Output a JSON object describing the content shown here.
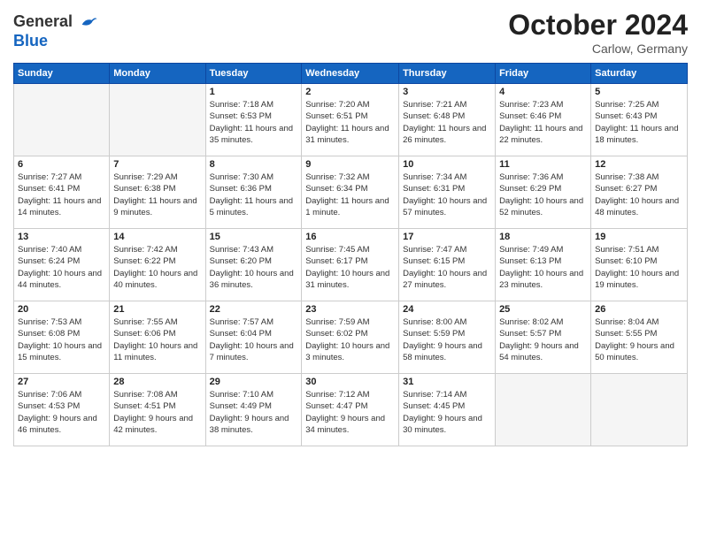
{
  "header": {
    "logo": {
      "general": "General",
      "blue": "Blue"
    },
    "title": "October 2024",
    "subtitle": "Carlow, Germany"
  },
  "days_of_week": [
    "Sunday",
    "Monday",
    "Tuesday",
    "Wednesday",
    "Thursday",
    "Friday",
    "Saturday"
  ],
  "weeks": [
    [
      {
        "day": "",
        "info": ""
      },
      {
        "day": "",
        "info": ""
      },
      {
        "day": "1",
        "info": "Sunrise: 7:18 AM\nSunset: 6:53 PM\nDaylight: 11 hours and 35 minutes."
      },
      {
        "day": "2",
        "info": "Sunrise: 7:20 AM\nSunset: 6:51 PM\nDaylight: 11 hours and 31 minutes."
      },
      {
        "day": "3",
        "info": "Sunrise: 7:21 AM\nSunset: 6:48 PM\nDaylight: 11 hours and 26 minutes."
      },
      {
        "day": "4",
        "info": "Sunrise: 7:23 AM\nSunset: 6:46 PM\nDaylight: 11 hours and 22 minutes."
      },
      {
        "day": "5",
        "info": "Sunrise: 7:25 AM\nSunset: 6:43 PM\nDaylight: 11 hours and 18 minutes."
      }
    ],
    [
      {
        "day": "6",
        "info": "Sunrise: 7:27 AM\nSunset: 6:41 PM\nDaylight: 11 hours and 14 minutes."
      },
      {
        "day": "7",
        "info": "Sunrise: 7:29 AM\nSunset: 6:38 PM\nDaylight: 11 hours and 9 minutes."
      },
      {
        "day": "8",
        "info": "Sunrise: 7:30 AM\nSunset: 6:36 PM\nDaylight: 11 hours and 5 minutes."
      },
      {
        "day": "9",
        "info": "Sunrise: 7:32 AM\nSunset: 6:34 PM\nDaylight: 11 hours and 1 minute."
      },
      {
        "day": "10",
        "info": "Sunrise: 7:34 AM\nSunset: 6:31 PM\nDaylight: 10 hours and 57 minutes."
      },
      {
        "day": "11",
        "info": "Sunrise: 7:36 AM\nSunset: 6:29 PM\nDaylight: 10 hours and 52 minutes."
      },
      {
        "day": "12",
        "info": "Sunrise: 7:38 AM\nSunset: 6:27 PM\nDaylight: 10 hours and 48 minutes."
      }
    ],
    [
      {
        "day": "13",
        "info": "Sunrise: 7:40 AM\nSunset: 6:24 PM\nDaylight: 10 hours and 44 minutes."
      },
      {
        "day": "14",
        "info": "Sunrise: 7:42 AM\nSunset: 6:22 PM\nDaylight: 10 hours and 40 minutes."
      },
      {
        "day": "15",
        "info": "Sunrise: 7:43 AM\nSunset: 6:20 PM\nDaylight: 10 hours and 36 minutes."
      },
      {
        "day": "16",
        "info": "Sunrise: 7:45 AM\nSunset: 6:17 PM\nDaylight: 10 hours and 31 minutes."
      },
      {
        "day": "17",
        "info": "Sunrise: 7:47 AM\nSunset: 6:15 PM\nDaylight: 10 hours and 27 minutes."
      },
      {
        "day": "18",
        "info": "Sunrise: 7:49 AM\nSunset: 6:13 PM\nDaylight: 10 hours and 23 minutes."
      },
      {
        "day": "19",
        "info": "Sunrise: 7:51 AM\nSunset: 6:10 PM\nDaylight: 10 hours and 19 minutes."
      }
    ],
    [
      {
        "day": "20",
        "info": "Sunrise: 7:53 AM\nSunset: 6:08 PM\nDaylight: 10 hours and 15 minutes."
      },
      {
        "day": "21",
        "info": "Sunrise: 7:55 AM\nSunset: 6:06 PM\nDaylight: 10 hours and 11 minutes."
      },
      {
        "day": "22",
        "info": "Sunrise: 7:57 AM\nSunset: 6:04 PM\nDaylight: 10 hours and 7 minutes."
      },
      {
        "day": "23",
        "info": "Sunrise: 7:59 AM\nSunset: 6:02 PM\nDaylight: 10 hours and 3 minutes."
      },
      {
        "day": "24",
        "info": "Sunrise: 8:00 AM\nSunset: 5:59 PM\nDaylight: 9 hours and 58 minutes."
      },
      {
        "day": "25",
        "info": "Sunrise: 8:02 AM\nSunset: 5:57 PM\nDaylight: 9 hours and 54 minutes."
      },
      {
        "day": "26",
        "info": "Sunrise: 8:04 AM\nSunset: 5:55 PM\nDaylight: 9 hours and 50 minutes."
      }
    ],
    [
      {
        "day": "27",
        "info": "Sunrise: 7:06 AM\nSunset: 4:53 PM\nDaylight: 9 hours and 46 minutes."
      },
      {
        "day": "28",
        "info": "Sunrise: 7:08 AM\nSunset: 4:51 PM\nDaylight: 9 hours and 42 minutes."
      },
      {
        "day": "29",
        "info": "Sunrise: 7:10 AM\nSunset: 4:49 PM\nDaylight: 9 hours and 38 minutes."
      },
      {
        "day": "30",
        "info": "Sunrise: 7:12 AM\nSunset: 4:47 PM\nDaylight: 9 hours and 34 minutes."
      },
      {
        "day": "31",
        "info": "Sunrise: 7:14 AM\nSunset: 4:45 PM\nDaylight: 9 hours and 30 minutes."
      },
      {
        "day": "",
        "info": ""
      },
      {
        "day": "",
        "info": ""
      }
    ]
  ]
}
